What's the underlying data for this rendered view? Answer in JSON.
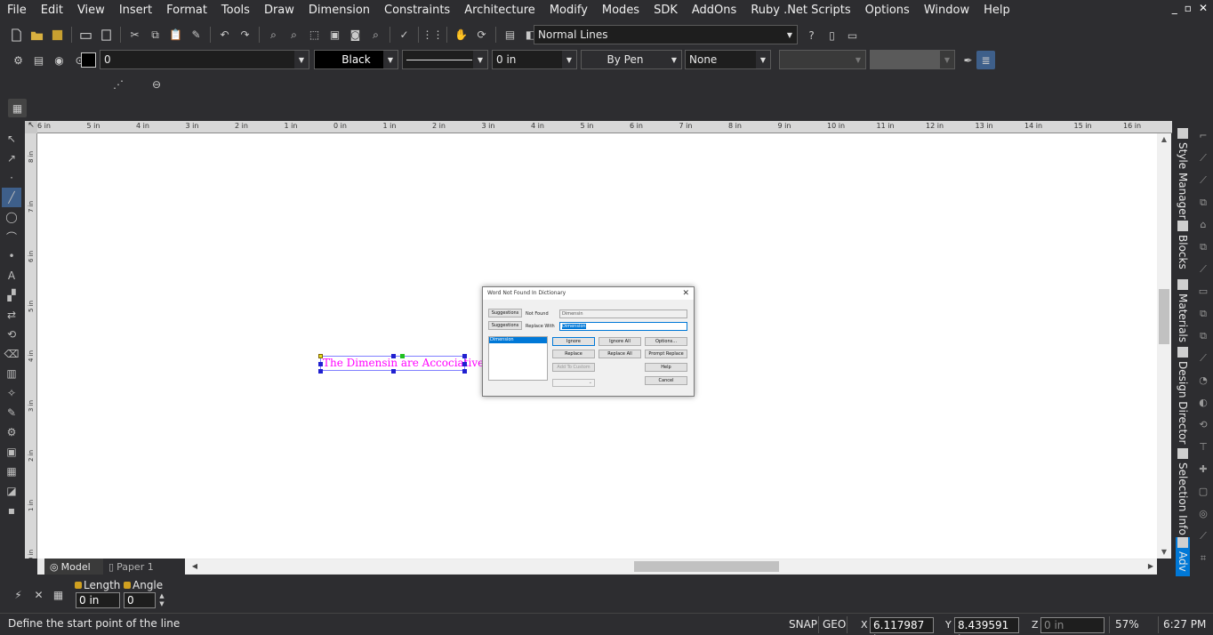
{
  "menubar": {
    "items": [
      "File",
      "Edit",
      "View",
      "Insert",
      "Format",
      "Tools",
      "Draw",
      "Dimension",
      "Constraints",
      "Architecture",
      "Modify",
      "Modes",
      "SDK",
      "AddOns",
      "Ruby .Net Scripts",
      "Options",
      "Window",
      "Help"
    ],
    "minimize": "_",
    "restore": "▫",
    "close": "✕"
  },
  "toolbar1": {
    "style_value": "Normal Lines"
  },
  "toolbar2": {
    "layer_value": "0",
    "color_value": "Black",
    "line_width_value": "0 in",
    "pen_value": "By Pen",
    "pattern_value": "None"
  },
  "drawing": {
    "text_entity": "The Dimensin are Accociative"
  },
  "dialog": {
    "title": "Word Not Found In Dictionary",
    "close": "✕",
    "suggestions_btn1": "Suggestions",
    "suggestions_btn2": "Suggestions",
    "not_found_label": "Not Found",
    "not_found_value": "Dimensin",
    "replace_with_label": "Replace With",
    "replace_with_value": "Dimension",
    "suggestion_item": "Dimension",
    "ignore": "Ignore",
    "ignore_all": "Ignore All",
    "options": "Options...",
    "replace": "Replace",
    "replace_all": "Replace All",
    "prompt_replace": "Prompt Replace",
    "add_to_custom": "Add To Custom",
    "help": "Help",
    "cancel": "Cancel"
  },
  "tabs": {
    "model": "Model",
    "paper": "Paper 1"
  },
  "right_dock": {
    "style_manager": "Style Manager",
    "blocks": "Blocks",
    "materials": "Materials",
    "design_director": "Design Director",
    "selection_info": "Selection Info",
    "advanced": "Adv"
  },
  "inspector": {
    "length_label": "Length",
    "angle_label": "Angle",
    "length_value": "0 in",
    "angle_value": "0"
  },
  "status": {
    "message": "Define the start point of the line",
    "snap": "SNAP",
    "geo": "GEO",
    "x_label": "X",
    "y_label": "Y",
    "z_label": "Z",
    "x_value": "6.117987 in",
    "y_value": "8.439591 in",
    "z_value": "0 in",
    "zoom": "57%",
    "time": "6:27 PM"
  },
  "ruler": {
    "h_labels": [
      "6 in",
      "5 in",
      "4 in",
      "3 in",
      "2 in",
      "1 in",
      "0 in",
      "1 in",
      "2 in",
      "3 in",
      "4 in",
      "5 in",
      "6 in",
      "7 in",
      "8 in",
      "9 in",
      "10 in",
      "11 in",
      "12 in",
      "13 in",
      "14 in",
      "15 in",
      "16 in",
      "17"
    ],
    "v_labels": [
      "8 in",
      "7 in",
      "6 in",
      "5 in",
      "4 in",
      "3 in",
      "2 in",
      "1 in",
      "0 in"
    ]
  }
}
